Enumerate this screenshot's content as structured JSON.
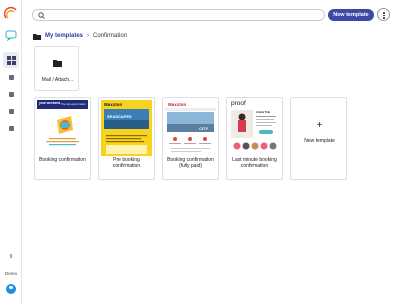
{
  "search": {
    "value": "",
    "placeholder": ""
  },
  "header": {
    "new_template_label": "New template"
  },
  "breadcrumb": {
    "root": "My templates",
    "current": "Confirmation"
  },
  "sidebar": {
    "count": "9",
    "workspace": "Demo"
  },
  "folders": [
    {
      "label": "Mail / Attach..."
    }
  ],
  "templates": [
    {
      "label": "Booking confirmation",
      "thumb_brand": "your weekend",
      "thumb_text": "The only way to travel"
    },
    {
      "label": "Pre booking confirmation",
      "thumb_brand": "Maxxton",
      "thumb_text": "SEASCAPES"
    },
    {
      "label": "Booking confirmation (fully paid)",
      "thumb_brand": "Maxxton",
      "thumb_text": "CITY"
    },
    {
      "label": "Last minute booking confirmation",
      "thumb_brand": "proof",
      "thumb_text": "Article Title"
    }
  ],
  "new_template_card": {
    "label": "New template"
  },
  "colors": {
    "accent": "#3c4aa6",
    "link": "#2e3a9a"
  }
}
